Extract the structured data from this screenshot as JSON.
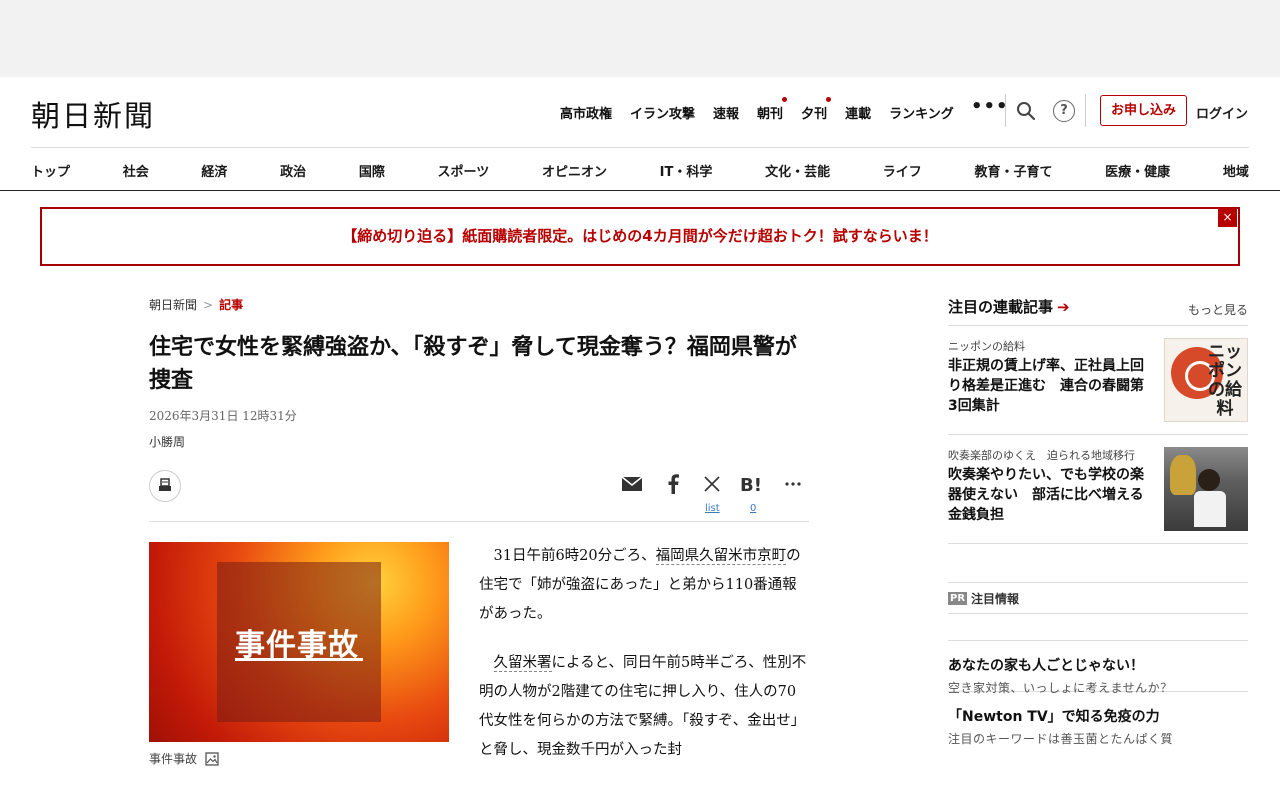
{
  "site": {
    "logo": "朝日新聞"
  },
  "topnav": {
    "items": [
      {
        "label": "高市政権",
        "dot": false
      },
      {
        "label": "イラン攻撃",
        "dot": false
      },
      {
        "label": "速報",
        "dot": false
      },
      {
        "label": "朝刊",
        "dot": true
      },
      {
        "label": "夕刊",
        "dot": true
      },
      {
        "label": "連載",
        "dot": false
      },
      {
        "label": "ランキング",
        "dot": false
      }
    ],
    "more": "•••",
    "help": "?",
    "subscribe": "お申し込み",
    "login": "ログイン"
  },
  "categories": [
    "トップ",
    "社会",
    "経済",
    "政治",
    "国際",
    "スポーツ",
    "オピニオン",
    "IT・科学",
    "文化・芸能",
    "ライフ",
    "教育・子育て",
    "医療・健康",
    "地域"
  ],
  "banner": {
    "text": "【締め切り迫る】紙面購読者限定。はじめの4カ月間が今だけ超おトク！試すならいま！",
    "close": "×"
  },
  "article": {
    "breadcrumb": [
      "朝日新聞",
      "記事"
    ],
    "breadcrumb_sep": ">",
    "title": "住宅で女性を緊縛強盗か、「殺すぞ」脅して現金奪う？福岡県警が捜査",
    "date": "2026年3月31日 12時31分",
    "author": "小勝周",
    "share": {
      "x_count": "list",
      "hatena_count": "0"
    },
    "figure": {
      "label": "事件事故",
      "caption": "事件事故"
    },
    "paragraphs": [
      {
        "before": "31日午前6時20分ごろ、",
        "link": "福岡県久留米市京町",
        "after": "の住宅で「姉が強盗にあった」と弟から110番通報があった。"
      },
      {
        "before": "",
        "link": "久留米署",
        "after": "によると、同日午前5時半ごろ、性別不明の人物が2階建ての住宅に押し入り、住人の70代女性を何らかの方法で緊縛。「殺すぞ、金出せ」と脅し、現金数千円が入った封"
      }
    ]
  },
  "sidebar": {
    "title": "注目の連載記事",
    "more": "もっと見る",
    "items": [
      {
        "kicker": "ニッポンの給料",
        "headline": "非正規の賃上げ率、正社員上回り格差是正進む　連合の春闘第3回集計",
        "thumb_text": "ニッポンの給料"
      },
      {
        "kicker": "吹奏楽部のゆくえ　迫られる地域移行",
        "headline": "吹奏楽やりたい、でも学校の楽器使えない　部活に比べ増える金銭負担"
      }
    ]
  },
  "pr": {
    "badge": "PR",
    "title": "注目情報",
    "items": [
      {
        "title": "あなたの家も人ごとじゃない！",
        "desc": "空き家対策、いっしょに考えませんか？"
      },
      {
        "title": "「Newton TV」で知る免疫の力",
        "desc": "注目のキーワードは善玉菌とたんぱく質"
      }
    ]
  }
}
